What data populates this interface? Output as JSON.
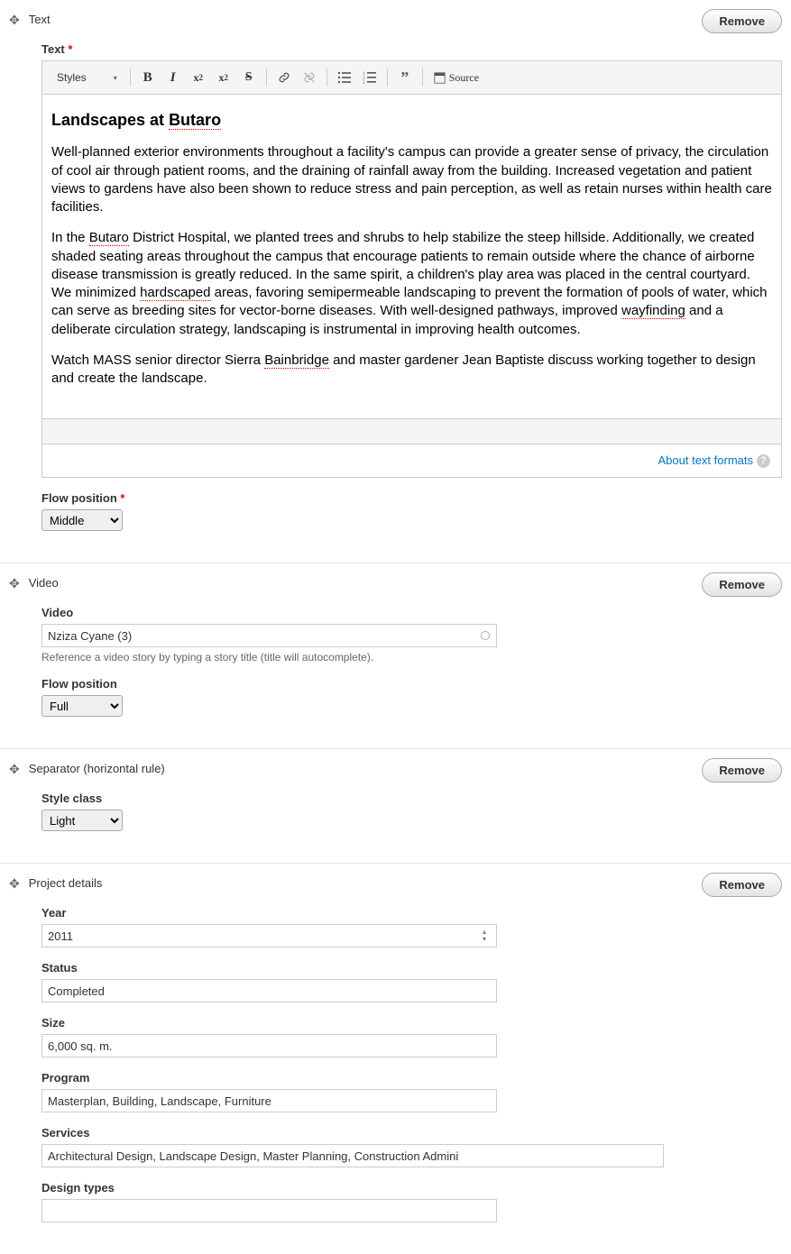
{
  "remove_label": "Remove",
  "sections": {
    "text": {
      "title": "Text",
      "field_label": "Text",
      "toolbar": {
        "styles": "Styles",
        "source": "Source"
      },
      "content": {
        "heading_prefix": "Landscapes at ",
        "heading_spell": "Butaro",
        "p1": "Well-planned exterior environments throughout a facility's campus can provide a greater sense of privacy, the circulation of cool air through patient rooms, and the draining of rainfall away from the building. Increased vegetation and patient views to gardens have also been shown to reduce stress and pain perception, as well as retain nurses within health care facilities.",
        "p2_a": "In the ",
        "p2_s1": "Butaro",
        "p2_b": " District Hospital, we planted trees and shrubs to help stabilize the steep hillside. Additionally, we created shaded seating areas throughout the campus that encourage patients to remain outside where the chance of airborne disease transmission is greatly reduced. In the same spirit, a children's play area was placed in the central courtyard. We minimized ",
        "p2_s2": "hardscaped",
        "p2_c": " areas, favoring semipermeable landscaping to prevent the formation of pools of water, which can serve as breeding sites for vector-borne diseases. With well-designed pathways, improved ",
        "p2_s3": "wayfinding",
        "p2_d": " and a deliberate circulation strategy, landscaping is instrumental in improving health outcomes.",
        "p3_a": "Watch MASS senior director Sierra ",
        "p3_s1": "Bainbridge",
        "p3_b": " and master gardener Jean Baptiste discuss working together to design and create the landscape."
      },
      "about_link": "About text formats",
      "flow_label": "Flow position",
      "flow_value": "Middle"
    },
    "video": {
      "title": "Video",
      "field_label": "Video",
      "value": "Nziza Cyane (3)",
      "hint": "Reference a video story by typing a story title (title will autocomplete).",
      "flow_label": "Flow position",
      "flow_value": "Full"
    },
    "separator": {
      "title": "Separator (horizontal rule)",
      "style_label": "Style class",
      "style_value": "Light"
    },
    "project": {
      "title": "Project details",
      "year_label": "Year",
      "year_value": "2011",
      "status_label": "Status",
      "status_value": "Completed",
      "size_label": "Size",
      "size_value": "6,000 sq. m.",
      "program_label": "Program",
      "program_value": "Masterplan, Building, Landscape, Furniture",
      "services_label": "Services",
      "services_value": "Architectural Design, Landscape Design, Master Planning, Construction Admini",
      "design_types_label": "Design types",
      "design_types_value": ""
    }
  }
}
